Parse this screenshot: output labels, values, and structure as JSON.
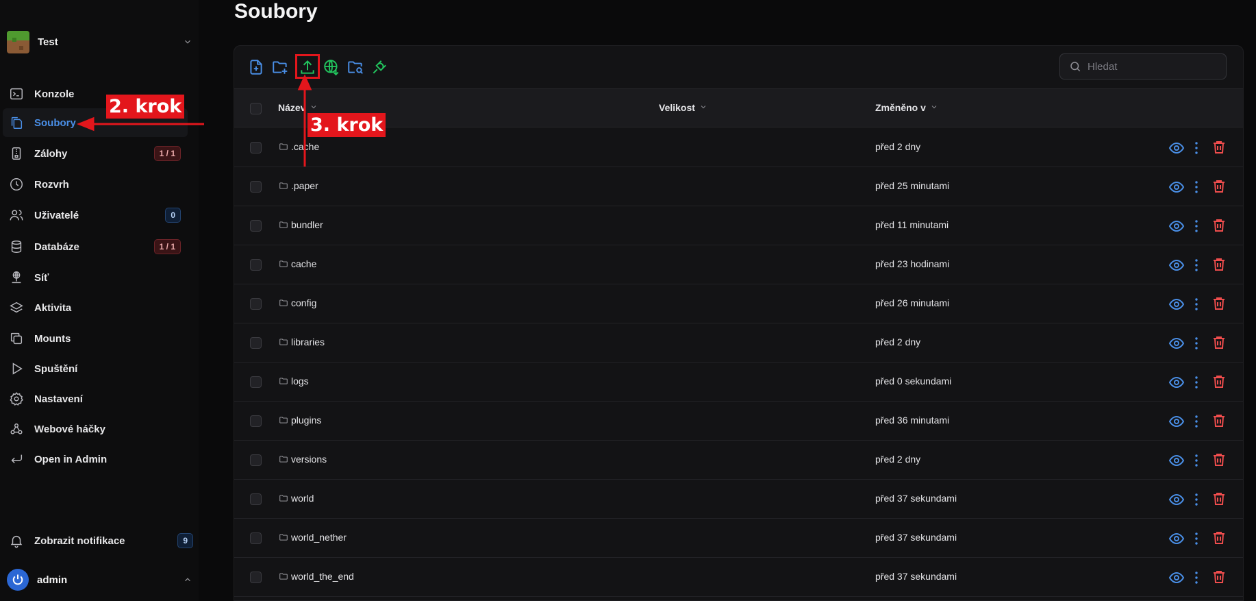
{
  "sidebar": {
    "server": {
      "name": "Test",
      "icon": "minecraft-grass-block-icon"
    },
    "items": [
      {
        "key": "console",
        "label": "Konzole",
        "icon": "terminal-icon",
        "badge": null,
        "active": false
      },
      {
        "key": "files",
        "label": "Soubory",
        "icon": "files-icon",
        "badge": null,
        "active": true
      },
      {
        "key": "backups",
        "label": "Zálohy",
        "icon": "archive-icon",
        "badge": "1 / 1",
        "badge_style": "red",
        "active": false
      },
      {
        "key": "schedule",
        "label": "Rozvrh",
        "icon": "clock-icon",
        "badge": null,
        "active": false
      },
      {
        "key": "users",
        "label": "Uživatelé",
        "icon": "users-icon",
        "badge": "0",
        "badge_style": "blue",
        "active": false
      },
      {
        "key": "databases",
        "label": "Databáze",
        "icon": "database-icon",
        "badge": "1 / 1",
        "badge_style": "red",
        "active": false
      },
      {
        "key": "network",
        "label": "Síť",
        "icon": "network-icon",
        "badge": null,
        "active": false
      },
      {
        "key": "activity",
        "label": "Aktivita",
        "icon": "layers-icon",
        "badge": null,
        "active": false
      },
      {
        "key": "mounts",
        "label": "Mounts",
        "icon": "copy-icon",
        "badge": null,
        "active": false
      },
      {
        "key": "startup",
        "label": "Spuštění",
        "icon": "play-icon",
        "badge": null,
        "active": false
      },
      {
        "key": "settings",
        "label": "Nastavení",
        "icon": "gear-icon",
        "badge": null,
        "active": false
      },
      {
        "key": "webhooks",
        "label": "Webové háčky",
        "icon": "webhook-icon",
        "badge": null,
        "active": false
      },
      {
        "key": "admin",
        "label": "Open in Admin",
        "icon": "return-icon",
        "badge": null,
        "active": false
      }
    ],
    "notifications": {
      "label": "Zobrazit notifikace",
      "count": "9"
    },
    "user": {
      "name": "admin"
    }
  },
  "page": {
    "title": "Soubory"
  },
  "toolbar": {
    "buttons": [
      "new-file-icon",
      "new-folder-icon",
      "upload-icon",
      "remote-download-icon",
      "search-folder-icon",
      "plug-icon"
    ],
    "search_placeholder": "Hledat"
  },
  "table": {
    "columns": {
      "name": "Název",
      "size": "Velikost",
      "modified": "Změněno v"
    },
    "rows": [
      {
        "name": ".cache",
        "modified": "před 2 dny"
      },
      {
        "name": ".paper",
        "modified": "před 25 minutami"
      },
      {
        "name": "bundler",
        "modified": "před 11 minutami"
      },
      {
        "name": "cache",
        "modified": "před 23 hodinami"
      },
      {
        "name": "config",
        "modified": "před 26 minutami"
      },
      {
        "name": "libraries",
        "modified": "před 2 dny"
      },
      {
        "name": "logs",
        "modified": "před 0 sekundami"
      },
      {
        "name": "plugins",
        "modified": "před 36 minutami"
      },
      {
        "name": "versions",
        "modified": "před 2 dny"
      },
      {
        "name": "world",
        "modified": "před 37 sekundami"
      },
      {
        "name": "world_nether",
        "modified": "před 37 sekundami"
      },
      {
        "name": "world_the_end",
        "modified": "před 37 sekundami"
      }
    ]
  },
  "annotations": {
    "step2": "2. krok",
    "step3": "3. krok",
    "color": "#e3161c"
  },
  "colors": {
    "accent": "#4a8fe7",
    "green": "#22c55e",
    "danger": "#ef4d4d"
  }
}
